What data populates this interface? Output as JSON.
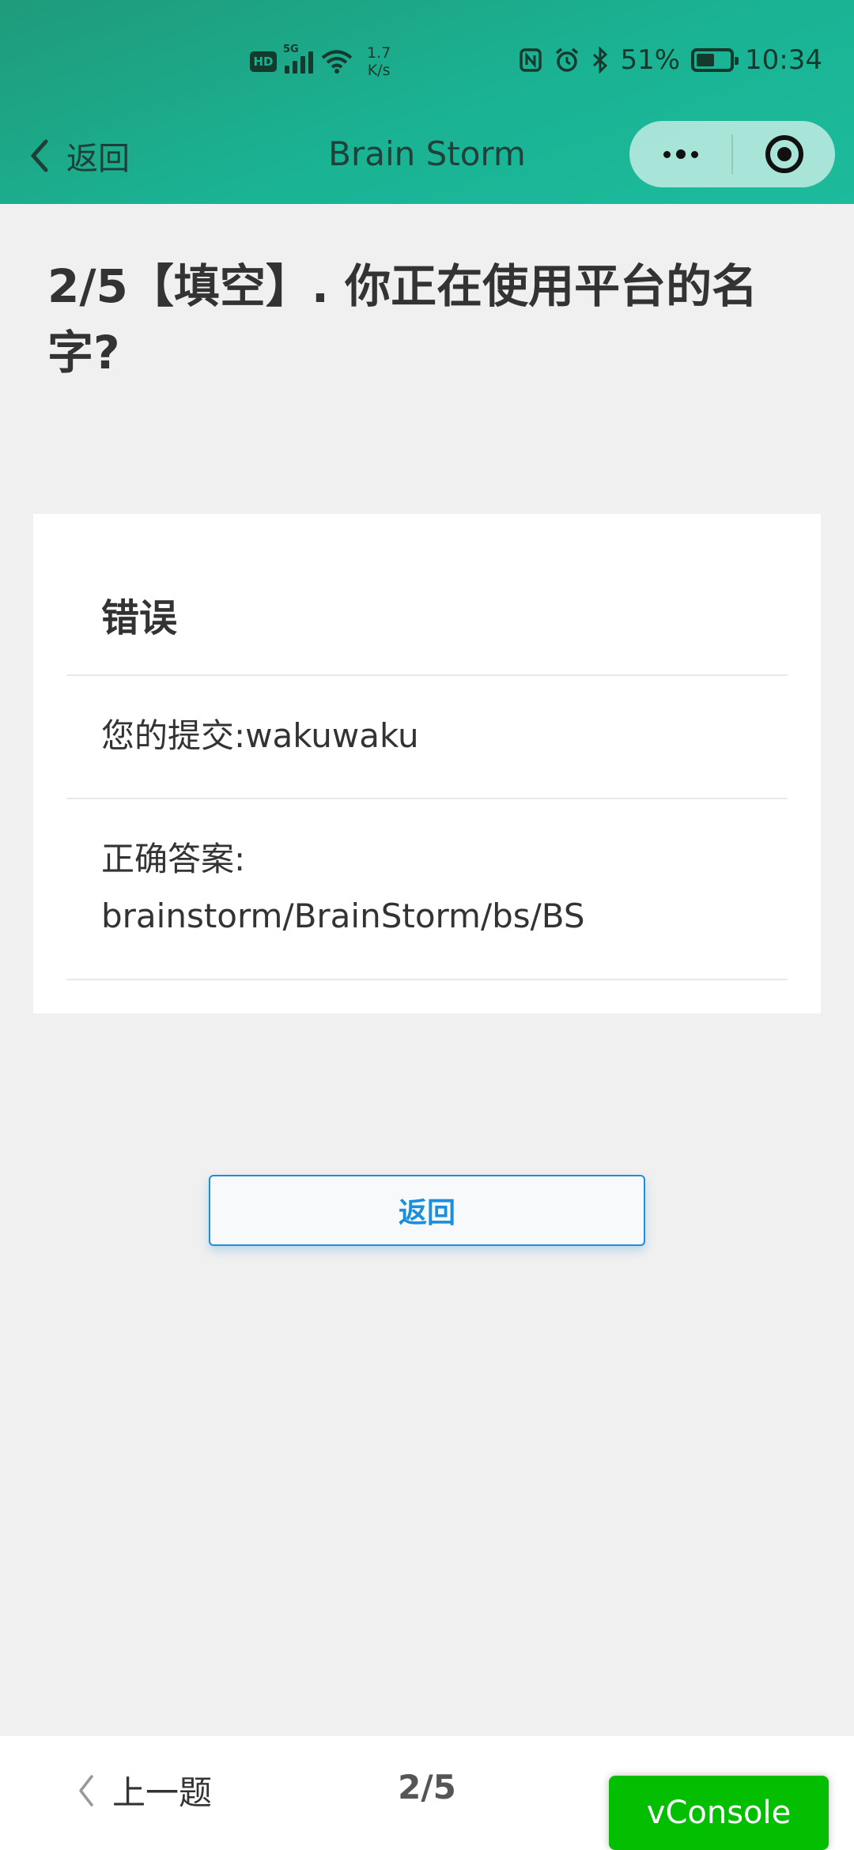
{
  "status_bar": {
    "hd": "HD",
    "network": "5G",
    "speed_value": "1.7",
    "speed_unit": "K/s",
    "battery": "51%",
    "time": "10:34"
  },
  "nav": {
    "back_label": "返回",
    "title": "Brain Storm"
  },
  "question": {
    "text": "2/5【填空】. 你正在使用平台的名字?"
  },
  "result": {
    "status": "错误",
    "submission_label": "您的提交:",
    "submission_value": "wakuwaku",
    "answer_label": "正确答案:",
    "answer_value": "brainstorm/BrainStorm/bs/BS"
  },
  "actions": {
    "return_button": "返回"
  },
  "bottom": {
    "prev_label": "上一题",
    "progress": "2/5",
    "vconsole": "vConsole"
  },
  "colors": {
    "header": "#1ab394",
    "accent": "#1b8fdc",
    "vconsole": "#04be02"
  }
}
